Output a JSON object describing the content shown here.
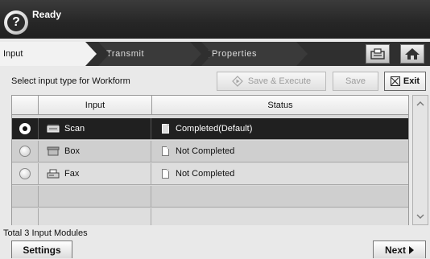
{
  "status": {
    "title": "Ready"
  },
  "workflow": {
    "steps": [
      {
        "label": "Input"
      },
      {
        "label": "Transmit"
      },
      {
        "label": "Properties"
      }
    ]
  },
  "toolbar": {
    "prompt": "Select input type for Workform",
    "save_execute_label": "Save & Execute",
    "save_label": "Save",
    "exit_label": "Exit"
  },
  "table": {
    "headers": {
      "input": "Input",
      "status": "Status"
    },
    "rows": [
      {
        "input": "Scan",
        "status": "Completed(Default)",
        "selected": true,
        "icon": "scanner-icon"
      },
      {
        "input": "Box",
        "status": "Not Completed",
        "selected": false,
        "icon": "box-icon"
      },
      {
        "input": "Fax",
        "status": "Not Completed",
        "selected": false,
        "icon": "fax-icon"
      }
    ]
  },
  "footer": {
    "total_text": "Total 3 Input Modules",
    "settings_label": "Settings",
    "next_label": "Next"
  },
  "colors": {
    "header_bg": "#262626",
    "selected_row": "#202020",
    "table_bg": "#d9d9d9"
  }
}
